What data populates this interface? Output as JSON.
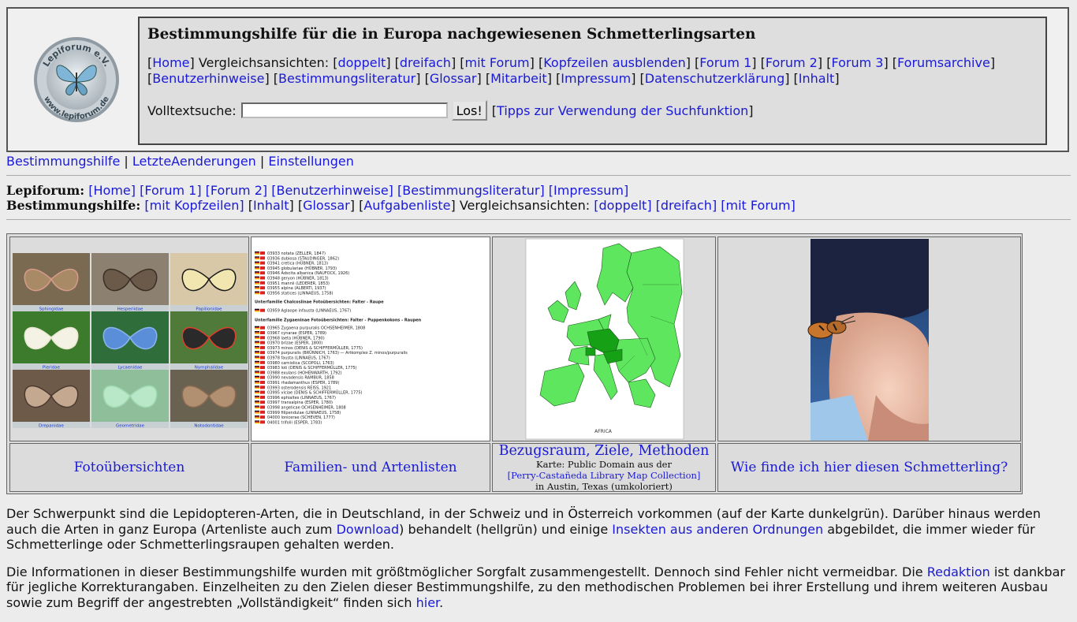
{
  "logo": {
    "text_top": "Lepiforum e.V.",
    "text_bottom": "www.lepiforum.de"
  },
  "header": {
    "title": "Bestimmungshilfe für die in Europa nachgewiesenen Schmetterlingsarten",
    "home": "Home",
    "compare_label": "Vergleichsansichten:",
    "doppelt": "doppelt",
    "dreifach": "dreifach",
    "mit_forum": "mit Forum",
    "kopfzeilen": "Kopfzeilen ausblenden",
    "forum1": "Forum 1",
    "forum2": "Forum 2",
    "forum3": "Forum 3",
    "forumsarchive": "Forumsarchive",
    "benutzerhinweise": "Benutzerhinweise",
    "bestimmungsliteratur": "Bestimmungsliteratur",
    "glossar": "Glossar",
    "mitarbeit": "Mitarbeit",
    "impressum": "Impressum",
    "datenschutz": "Datenschutzerklärung",
    "inhalt": "Inhalt",
    "search_label": "Volltextsuche:",
    "search_value": "",
    "search_button": "Los!",
    "search_tips": "Tipps zur Verwendung der Suchfunktion"
  },
  "wiki_nav": {
    "bestimmungshilfe": "Bestimmungshilfe",
    "letzte": "LetzteAenderungen",
    "einstellungen": "Einstellungen"
  },
  "lepiforum_line": {
    "label": "Lepiforum:",
    "home": "[Home]",
    "forum1": "[Forum 1]",
    "forum2": "[Forum 2]",
    "benutzerhinweise": "[Benutzerhinweise]",
    "bestimmungsliteratur": "[Bestimmungsliteratur]",
    "impressum": "[Impressum]"
  },
  "bestimmung_line": {
    "label": "Bestimmungshilfe:",
    "mit_kopfzeilen": "[mit Kopfzeilen]",
    "inhalt": "Inhalt",
    "glossar": "Glossar",
    "aufgabenliste": "Aufgabenliste",
    "compare_label": "Vergleichsansichten:",
    "doppelt": "[doppelt]",
    "dreifach": "[dreifach]",
    "mit_forum": "[mit Forum]"
  },
  "photo_grid": {
    "families": [
      "Sphingidae",
      "Hesperiidae",
      "Papilionidae",
      "Pieridae",
      "Lycaenidae",
      "Nymphalidae",
      "Drepanidae",
      "Geometridae",
      "Notodontidae"
    ]
  },
  "species_list": {
    "rows_a": [
      "03933 notata (ZELLER, 1847)",
      "03936 dubiosa (STAUDINGER, 1862)",
      "03941 cretica (HÜBNER, 1813)",
      "03945 globulariae (HÜBNER, 1793)",
      "03946 Adscita albanica (NAUFOCK, 1926)",
      "03948 geryon (HÜBNER, 1813)",
      "03951 mannii (LEDERER, 1853)",
      "03955 alpina (ALBERTI, 1937)",
      "03956 statices (LINNAEUS, 1758)"
    ],
    "subfamily1": "Unterfamilie Chalcosiinae",
    "subfamily1_links": "Fotoübersichten: Falter - Raupe",
    "single_row": "03959 Aglaope infausta (LINNAEUS, 1767)",
    "subfamily2": "Unterfamilie Zygaeninae",
    "subfamily2_links": "Fotoübersichten: Falter - Puppenkokons - Raupen",
    "rows_b": [
      "03965 Zygaena purpuralis OCHSENHEIMER, 1808",
      "03967 cynarae (ESPER, 1789)",
      "03968 laeta (HÜBNER, 1790)",
      "03970 brizae (ESPER, 1800)",
      "03973 minos (DENIS & SCHIFFERMÜLLER, 1775)",
      "03974 purpuralis (BRÜNNICH, 1763) — Artkomplex Z. minos/purpuralis",
      "03978 fausta (LINNAEUS, 1767)",
      "03980 carniolica (SCOPOLI, 1763)",
      "03983 loti (DENIS & SCHIFFERMÜLLER, 1775)",
      "03988 exulans (HOHENWARTH, 1792)",
      "03990 nevadensis RAMBUR, 1858",
      "03991 rhadamanthus (ESPER, 1789)",
      "03993 osterodensis REISS, 1921",
      "03995 viciae (DENIS & SCHIFFERMÜLLER, 1775)",
      "03996 ephialtes (LINNAEUS, 1767)",
      "03997 transalpina (ESPER, 1780)",
      "03998 angelicae OCHSENHEIMER, 1808",
      "03999 filipendulae (LINNAEUS, 1758)",
      "04000 lonicerae (SCHEVEN, 1777)",
      "04001 trifolii (ESPER, 1783)"
    ]
  },
  "captions": {
    "fotouebersichten": "Fotoübersichten",
    "familien": "Familien- und Artenlisten",
    "bezugsraum": "Bezugsraum, Ziele, Methoden",
    "karte_line": "Karte: Public Domain aus der",
    "perry": "[Perry-Castañeda Library Map Collection]",
    "austin": "in Austin, Texas (umkoloriert)",
    "wie_finde": "Wie finde ich hier diesen Schmetterling?"
  },
  "paragraph1": {
    "part1": "Der Schwerpunkt sind die Lepidopteren-Arten, die in Deutschland, in der Schweiz und in Österreich vorkommen (auf der Karte dunkelgrün). Darüber hinaus werden auch die Arten in ganz Europa (Artenliste auch zum ",
    "download": "Download",
    "part2": ") behandelt (hellgrün) und einige ",
    "insekten": "Insekten aus anderen Ordnungen",
    "part3": " abgebildet, die immer wieder für Schmetterlinge oder Schmetterlingsraupen gehalten werden."
  },
  "paragraph2": {
    "part1": "Die Informationen in dieser Bestimmungshilfe wurden mit größtmöglicher Sorgfalt zusammengestellt. Dennoch sind Fehler nicht vermeidbar. Die ",
    "redaktion": "Redaktion",
    "part2": " ist dankbar für jegliche Korrekturangaben. Einzelheiten zu den Zielen dieser Bestimmungshilfe, zu den methodischen Problemen bei ihrer Erstellung und ihrem weiteren Ausbau sowie zum Begriff der angestrebten „Vollständigkeit“ finden sich ",
    "hier": "hier",
    "part3": "."
  },
  "colors": {
    "link": "#1a1ad6",
    "caption_link": "#0000c8",
    "map_green_light": "#5ee65e",
    "map_green_dark": "#16a016",
    "background": "#ececec"
  }
}
